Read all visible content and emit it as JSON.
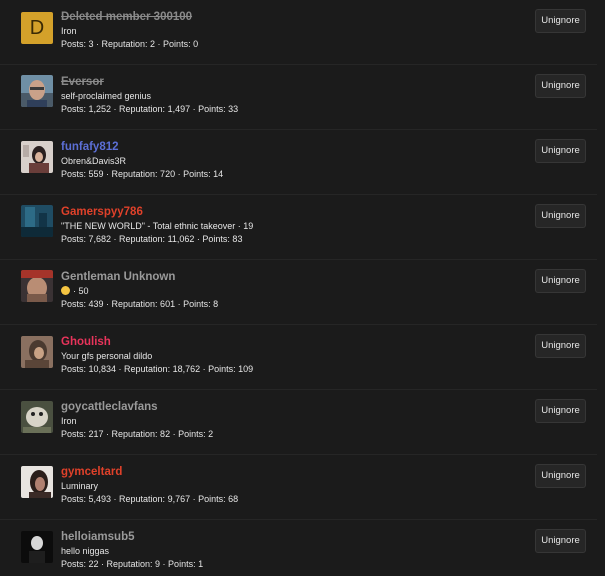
{
  "button_label": "Unignore",
  "members": [
    {
      "name": "Deleted member 300100",
      "title": "Iron",
      "stats": "Posts: 3 · Reputation: 2 · Points: 0",
      "avatar_letter": "D"
    },
    {
      "name": "Eversor",
      "title": "self-proclaimed genius",
      "stats": "Posts: 1,252 · Reputation: 1,497 · Points: 33"
    },
    {
      "name": "funfafy812",
      "title": "Obren&Davis3R",
      "stats": "Posts: 559 · Reputation: 720 · Points: 14"
    },
    {
      "name": "Gamerspyy786",
      "title": "\"THE NEW WORLD\" - Total ethnic takeover · 19",
      "stats": "Posts: 7,682 · Reputation: 11,062 · Points: 83"
    },
    {
      "name": "Gentleman Unknown",
      "title": "· 50",
      "stats": "Posts: 439 · Reputation: 601 · Points: 8"
    },
    {
      "name": "Ghoulish",
      "title": "Your gfs personal dildo",
      "stats": "Posts: 10,834 · Reputation: 18,762 · Points: 109"
    },
    {
      "name": "goycattleclavfans",
      "title": "Iron",
      "stats": "Posts: 217 · Reputation: 82 · Points: 2"
    },
    {
      "name": "gymceltard",
      "title": "Luminary",
      "stats": "Posts: 5,493 · Reputation: 9,767 · Points: 68"
    },
    {
      "name": "helloiamsub5",
      "title": "hello niggas",
      "stats": "Posts: 22 · Reputation: 9 · Points: 1"
    }
  ],
  "colors": {
    "background": "#1b1b1b",
    "deleted": "#8a8a8a",
    "grey": "#9a9a9a",
    "blue": "#5c6fd6",
    "red": "#e0412a",
    "pink": "#e8345b",
    "deleted_avatar": "#d4a12a"
  }
}
